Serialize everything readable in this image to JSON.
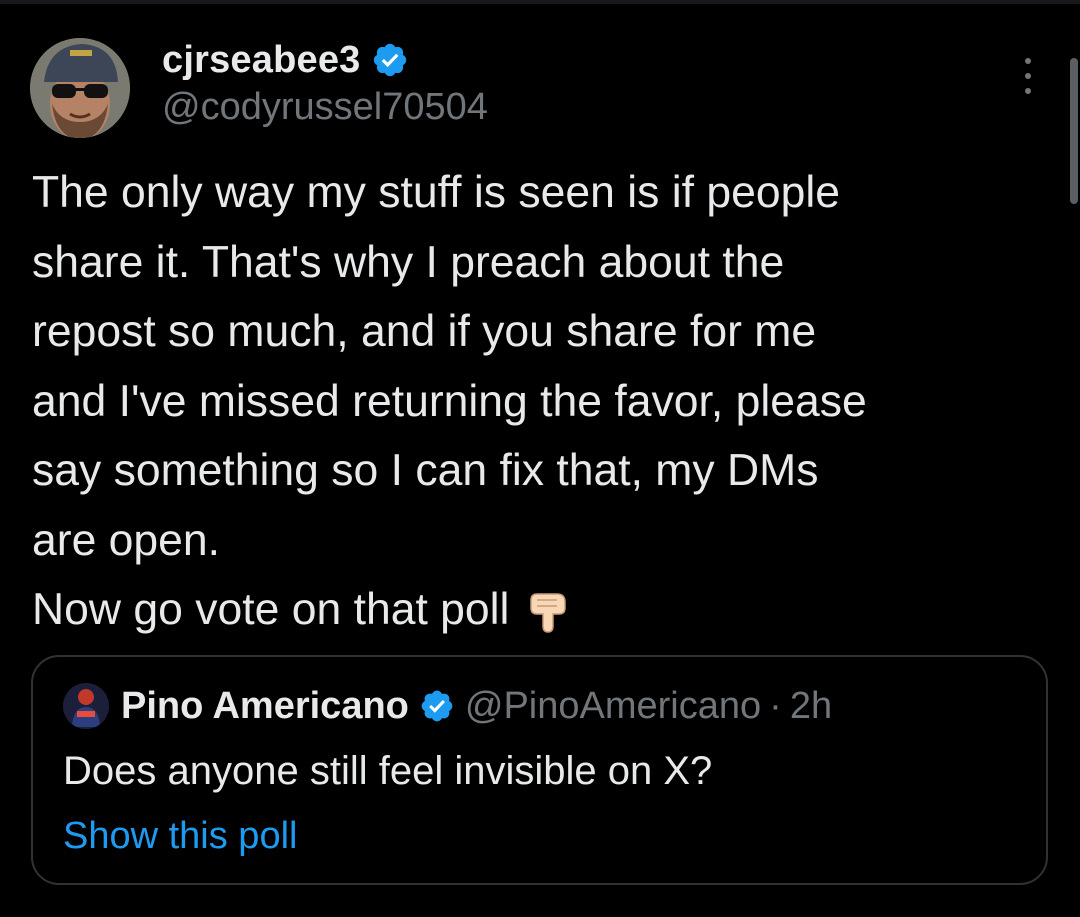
{
  "colors": {
    "background": "#000000",
    "text_primary": "#e7e9ea",
    "text_secondary": "#71767b",
    "accent_blue": "#1d9bf0",
    "border": "#2f3336"
  },
  "post": {
    "author": {
      "display_name": "cjrseabee3",
      "handle": "@codyrussel70504",
      "verified_icon": "verified-badge-icon",
      "avatar_icon": "profile-photo-avatar"
    },
    "more_icon": "more-options-icon",
    "text_lines": [
      "The only way my stuff is seen is if people",
      "share it. That's why I preach about the",
      "repost so much, and if you share for me",
      "and I've missed returning the favor, please",
      "say something so I can fix that, my DMs",
      "are open.",
      "Now go vote on that poll"
    ],
    "emoji": "backhand-index-pointing-down-icon"
  },
  "quoted_post": {
    "display_name": "Pino Americano",
    "handle": "@PinoAmericano",
    "separator": "·",
    "time": "2h",
    "text": "Does anyone still feel invisible on X?",
    "link_label": "Show this poll",
    "verified_icon": "verified-badge-icon",
    "avatar_icon": "quoted-profile-avatar"
  }
}
